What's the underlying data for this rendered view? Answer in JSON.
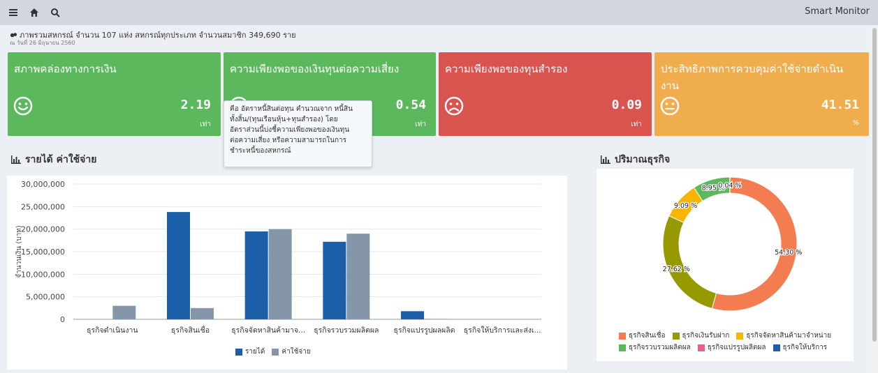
{
  "app_title": "Smart Monitor",
  "header": {
    "summary": "ภาพรวมสหกรณ์ จำนวน 107 แห่ง สหกรณ์ทุกประเภท จำนวนสมาชิก 349,690 ราย",
    "date": "ณ วันที่ 26 มิถุนายน 2560"
  },
  "kpis": [
    {
      "title": "สภาพคล่องทางการเงิน",
      "value": "2.19",
      "unit": "เท่า",
      "mood": "happy",
      "color": "#5cb85c"
    },
    {
      "title": "ความเพียงพอของเงินทุนต่อความเสี่ยง",
      "value": "0.54",
      "unit": "เท่า",
      "mood": "happy",
      "color": "#5cb85c"
    },
    {
      "title": "ความเพียงพอของทุนสำรอง",
      "value": "0.09",
      "unit": "เท่า",
      "mood": "sad",
      "color": "#d9534f"
    },
    {
      "title": "ประสิทธิภาพการควบคุมค่าใช้จ่ายดำเนินงาน",
      "value": "41.51",
      "unit": "%",
      "mood": "neutral",
      "color": "#f0ad4e"
    }
  ],
  "tooltip": {
    "lines": [
      "คือ อัตราหนี้สินต่อทุน คำนวณจาก หนี้สิน",
      "ทั้งสิ้น/(ทุนเรือนหุ้น+ทุนสำรอง) โดย",
      "อัตราส่วนนี้บ่งชี้ความเพียงพอของเงินทุน",
      "ต่อความเสี่ยง หรือความสามารถในการ",
      "ชำระหนี้ของสหกรณ์"
    ]
  },
  "panels": {
    "income_title": "รายได้ ค่าใช้จ่าย",
    "business_title": "ปริมาณธุรกิจ"
  },
  "colors": {
    "income": "#1a5fa8",
    "expense": "#8496a8",
    "gridline": "#e6e6e6"
  },
  "chart_data": [
    {
      "type": "bar",
      "title": "",
      "xlabel": "",
      "ylabel": "จำนวนเงิน (บาท)",
      "ylim": [
        0,
        30000000
      ],
      "yticks": [
        "0",
        "5,000,000",
        "10,000,000",
        "15,000,000",
        "20,000,000",
        "25,000,000",
        "30,000,000"
      ],
      "categories": [
        "ธุรกิจดำเนินงาน",
        "ธุรกิจสินเชื่อ",
        "ธุรกิจจัดหาสินค้ามาจ...",
        "ธุรกิจรวบรวมผลิตผล",
        "ธุรกิจแปรรูปผลผลิต",
        "ธุรกิจให้บริการและส่งเ..."
      ],
      "series": [
        {
          "name": "รายได้",
          "color": "#1a5fa8",
          "values": [
            0,
            23800000,
            19500000,
            17200000,
            1800000,
            0
          ]
        },
        {
          "name": "ค่าใช้จ่าย",
          "color": "#8496a8",
          "values": [
            3000000,
            2500000,
            20000000,
            19000000,
            100000,
            0
          ]
        }
      ],
      "grid": true,
      "legend": "bottom"
    },
    {
      "type": "pie",
      "title": "",
      "slices": [
        {
          "name": "ธุรกิจสินเชื่อ",
          "value": 54.3,
          "label": "54.30 %",
          "color": "#f47c51"
        },
        {
          "name": "ธุรกิจเงินรับฝาก",
          "value": 27.62,
          "label": "27.62 %",
          "color": "#969a00"
        },
        {
          "name": "ธุรกิจจัดหาสินค้ามาจำหน่าย",
          "value": 9.09,
          "label": "9.09 %",
          "color": "#f7b500"
        },
        {
          "name": "ธุรกิจรวบรวมผลิตผล",
          "value": 8.95,
          "label": "8.95 %",
          "color": "#5cb85c"
        },
        {
          "name": "ธุรกิจแปรรูปผลิตผล",
          "value": 0.0,
          "label": "",
          "color": "#e85f8e"
        },
        {
          "name": "ธุรกิจให้บริการ",
          "value": 0.04,
          "label": "0.04 %",
          "color": "#1a5fa8"
        }
      ],
      "legend": "bottom"
    }
  ]
}
